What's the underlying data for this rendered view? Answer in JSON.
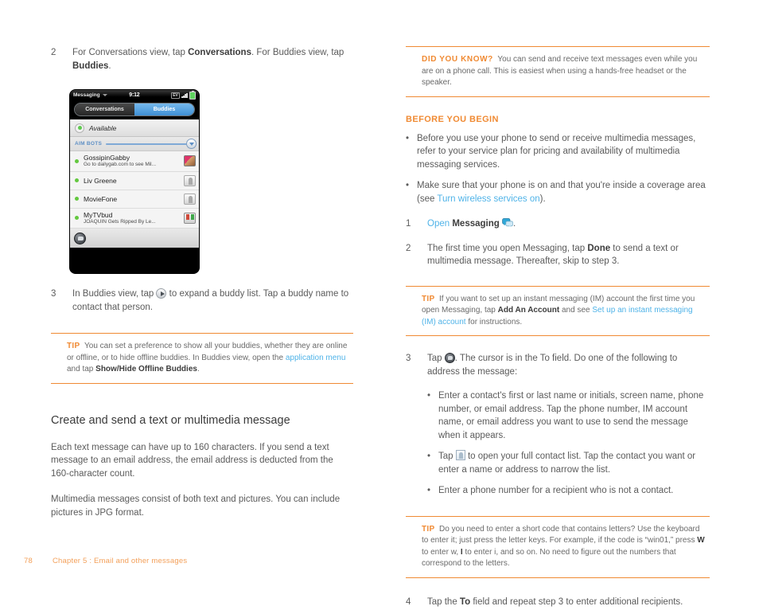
{
  "left": {
    "step2": {
      "num": "2",
      "t1": "For Conversations view, tap ",
      "b1": "Conversations",
      "t2": ". For Buddies view, tap ",
      "b2": "Buddies",
      "t3": "."
    },
    "step3": {
      "num": "3",
      "t1": "In Buddies view, tap ",
      "t2": " to expand a buddy list. Tap a buddy name to contact that person."
    },
    "tip": {
      "label": "TIP",
      "t1": "You can set a preference to show all your buddies, whether they are online or offline, or to hide offline buddies. In Buddies view, open the ",
      "link": "application menu",
      "t2": " and tap ",
      "b1": "Show/Hide Offline Buddies",
      "t3": "."
    },
    "section_heading": "Create and send a text or multimedia message",
    "para1": "Each text message can have up to 160 characters. If you send a text message to an email address, the email address is deducted from the 160-character count.",
    "para2": "Multimedia messages consist of both text and pictures. You can include pictures in JPG format."
  },
  "phone": {
    "status": {
      "app": "Messaging",
      "time": "9:12",
      "network": "EV"
    },
    "tabs": {
      "conversations": "Conversations",
      "buddies": "Buddies"
    },
    "availability": "Available",
    "group": "AIM BOTS",
    "buddies": [
      {
        "name": "GossipinGabby",
        "sub": "Go to dailygab.com to see Mil...",
        "avatar": "photo"
      },
      {
        "name": "Liv Greene",
        "sub": "",
        "avatar": "generic"
      },
      {
        "name": "MovieFone",
        "sub": "",
        "avatar": "generic"
      },
      {
        "name": "MyTVbud",
        "sub": "JOAQUIN Gets Ripped By Le...",
        "avatar": "tv"
      }
    ]
  },
  "right": {
    "did_you_know": {
      "label": "DID YOU KNOW?",
      "text": "You can send and receive text messages even while you are on a phone call. This is easiest when using a hands-free headset or the speaker."
    },
    "before_you_begin": {
      "heading": "BEFORE YOU BEGIN",
      "bullet1": "Before you use your phone to send or receive multimedia messages, refer to your service plan for pricing and availability of multimedia messaging services.",
      "bullet2_t1": "Make sure that your phone is on and that you're inside a coverage area (see ",
      "bullet2_link": "Turn wireless services on",
      "bullet2_t2": ")."
    },
    "step1": {
      "num": "1",
      "link": "Open",
      "b1": "Messaging",
      "t2": "."
    },
    "step2": {
      "num": "2",
      "t1": "The first time you open Messaging, tap ",
      "b1": "Done",
      "t2": " to send a text or multimedia message. Thereafter, skip to step 3."
    },
    "tip1": {
      "label": "TIP",
      "t1": "If you want to set up an instant messaging (IM) account the first time you open Messaging, tap ",
      "b1": "Add An Account",
      "t2": " and see ",
      "link": "Set up an instant messaging (IM) account",
      "t3": " for instructions."
    },
    "step3": {
      "num": "3",
      "t1": "Tap ",
      "t2": ". The cursor is in the To field. Do one of the following to address the message:",
      "sub1": "Enter a contact's first or last name or initials, screen name, phone number, or email address. Tap the phone number, IM account name, or email address you want to use to send the message when it appears.",
      "sub2_t1": "Tap ",
      "sub2_t2": " to open your full contact list. Tap the contact you want or enter a name or address to narrow the list.",
      "sub3": "Enter a phone number for a recipient who is not a contact."
    },
    "tip2": {
      "label": "TIP",
      "t1": "Do you need to enter a short code that contains letters? Use the keyboard to enter it; just press the letter keys. For example, if the code is “win01,” press ",
      "b1": "W",
      "t2": " to enter w, ",
      "b2": "I",
      "t3": " to enter i, and so on. No need to figure out the numbers that correspond to the letters."
    },
    "step4": {
      "num": "4",
      "t1": "Tap the ",
      "b1": "To",
      "t2": " field and repeat step 3 to enter additional recipients."
    }
  },
  "footer": {
    "page": "78",
    "chapter": "Chapter 5  :  Email and other messages"
  },
  "colors": {
    "accent_orange": "#f08a33",
    "link_blue": "#4fb3e8",
    "body_gray": "#5b5b5b"
  }
}
